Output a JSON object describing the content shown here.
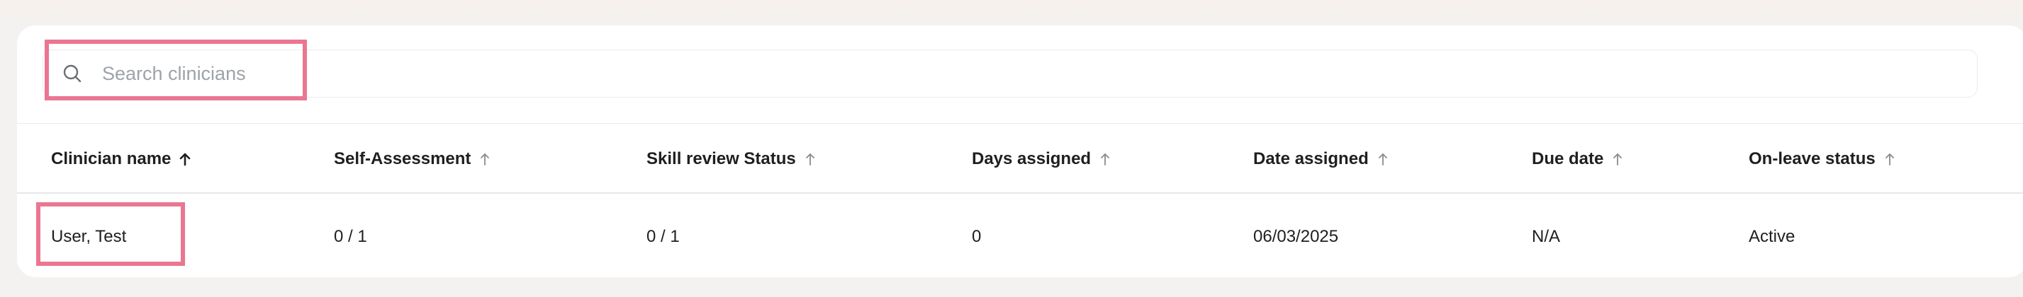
{
  "search": {
    "placeholder": "Search clinicians",
    "icon": "search-icon"
  },
  "table": {
    "columns": [
      {
        "label": "Clinician name",
        "sort": "ascending-active"
      },
      {
        "label": "Self-Assessment",
        "sort": "ascending"
      },
      {
        "label": "Skill review Status",
        "sort": "ascending"
      },
      {
        "label": "Days assigned",
        "sort": "ascending"
      },
      {
        "label": "Date assigned",
        "sort": "ascending"
      },
      {
        "label": "Due date",
        "sort": "ascending"
      },
      {
        "label": "On-leave status",
        "sort": "ascending"
      }
    ],
    "rows": [
      {
        "clinician_name": "User, Test",
        "self_assessment": "0 / 1",
        "skill_review_status": "0 / 1",
        "days_assigned": "0",
        "date_assigned": "06/03/2025",
        "due_date": "N/A",
        "on_leave_status": "Active"
      }
    ]
  },
  "colors": {
    "highlight": "#ea7691",
    "text": "#1f1f1f",
    "placeholder": "#9ea3a8",
    "active_sort": "#1f1f1f",
    "inactive_sort": "#8a8a8a"
  }
}
